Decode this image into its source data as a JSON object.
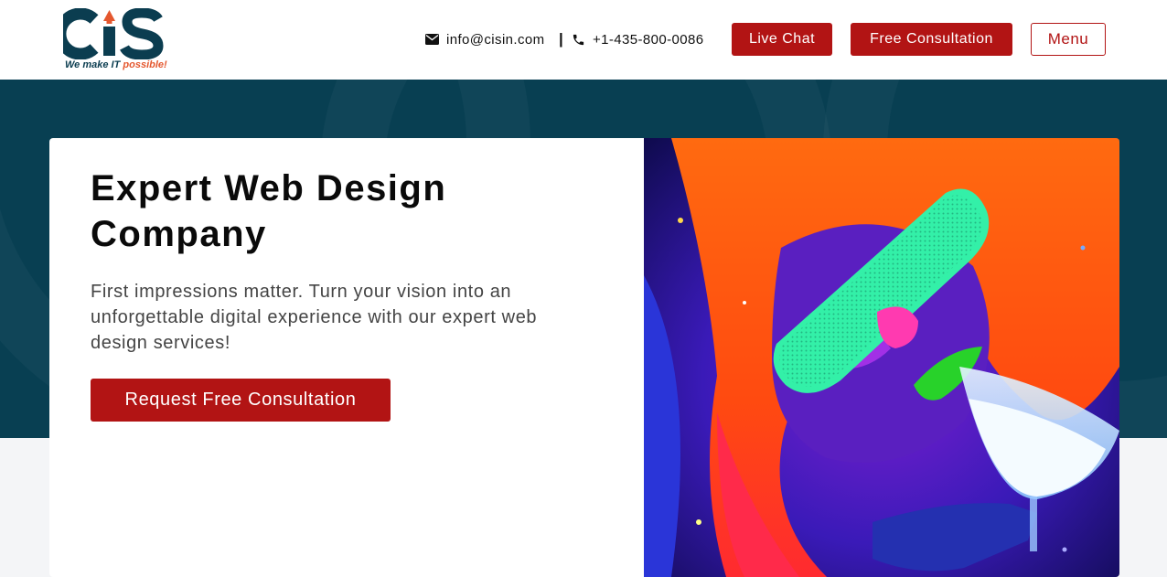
{
  "header": {
    "logo_tagline_part1": "We make IT ",
    "logo_tagline_part2": "possible!",
    "email": "info@cisin.com",
    "separator": "|",
    "phone": "+1-435-800-0086",
    "live_chat_label": "Live Chat",
    "free_consultation_label": "Free Consultation",
    "menu_label": "Menu"
  },
  "hero": {
    "title": "Expert Web Design Company",
    "description": "First impressions matter. Turn your vision into an unforgettable digital experience with our expert web design services!",
    "cta_label": "Request Free Consultation"
  },
  "colors": {
    "brand_red": "#b21414",
    "brand_teal": "#083f52",
    "logo_teal": "#0b3d50",
    "logo_orange": "#e4572e"
  },
  "icons": [
    "envelope-icon",
    "phone-icon"
  ]
}
